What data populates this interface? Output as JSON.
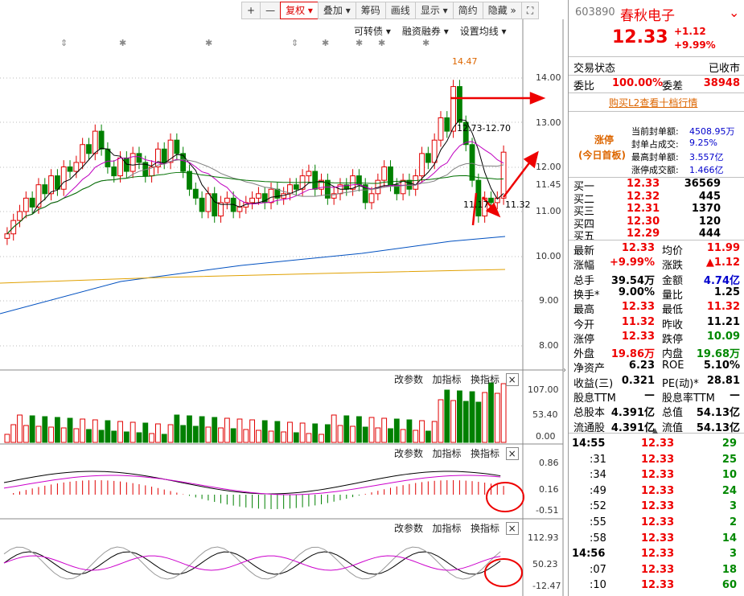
{
  "toolbar": {
    "zoom_in": "+",
    "zoom_out": "—",
    "fuquan": "复权",
    "diejia": "叠加",
    "chouma": "筹码",
    "huaxian": "画线",
    "xianshi": "显示",
    "jianyue": "简约",
    "yincang": "隐藏"
  },
  "chart_menu": {
    "kezhuan": "可转债",
    "rongzi": "融资融券",
    "junxian": "设置均线"
  },
  "price_axis": [
    "14.00",
    "13.00",
    "12.00",
    "11.45",
    "11.00",
    "10.00",
    "9.00",
    "8.00"
  ],
  "annotations": {
    "high": "14.47",
    "mid": "12.73-12.70",
    "low": "11.17",
    "lowr": "11.32"
  },
  "sub_menu": {
    "gai": "改参数",
    "jia": "加指标",
    "huan": "换指标",
    "close": "×"
  },
  "vol_axis": [
    "107.00",
    "53.40",
    "0.00"
  ],
  "macd_axis": [
    "0.86",
    "0.16",
    "-0.51"
  ],
  "kdj_axis": [
    "112.93",
    "50.23",
    "-12.47"
  ],
  "colors": {
    "up": "#e00000",
    "down": "#008000",
    "ma5": "#000000",
    "ma10": "#c000c0",
    "ma20": "#808080",
    "ma60": "#007000",
    "ma120": "#0050c0",
    "ma250": "#e0a000"
  },
  "stock": {
    "code": "603890",
    "name": "春秋电子",
    "price": "12.33",
    "change": "+1.12",
    "pct": "+9.99%"
  },
  "status": {
    "label": "交易状态",
    "value": "已收市"
  },
  "weibi": {
    "l1": "委比",
    "v1": "100.00%",
    "l2": "委差",
    "v2": "38948"
  },
  "l2_link": "购买L2查看十档行情",
  "zt": {
    "title": "涨停",
    "sub": "(今日首板)",
    "r1": "当前封单额:",
    "v1": "4508.95万",
    "r2": "封单占成交:",
    "v2": "9.25%",
    "r3": "最高封单额:",
    "v3": "3.557亿",
    "r4": "涨停成交额:",
    "v4": "1.466亿"
  },
  "bids": [
    [
      "买一",
      "12.33",
      "36569"
    ],
    [
      "买二",
      "12.32",
      "445"
    ],
    [
      "买三",
      "12.31",
      "1370"
    ],
    [
      "买四",
      "12.30",
      "120"
    ],
    [
      "买五",
      "12.29",
      "444"
    ]
  ],
  "quote": [
    [
      "最新",
      "12.33",
      "均价",
      "11.99"
    ],
    [
      "涨幅",
      "+9.99%",
      "涨跌",
      "▲1.12"
    ],
    [
      "总手",
      "39.54万",
      "金额",
      "4.74亿"
    ],
    [
      "换手*",
      "9.00%",
      "量比",
      "1.25"
    ],
    [
      "最高",
      "12.33",
      "最低",
      "11.32"
    ],
    [
      "今开",
      "11.32",
      "昨收",
      "11.21"
    ],
    [
      "涨停",
      "12.33",
      "跌停",
      "10.09"
    ],
    [
      "外盘",
      "19.86万",
      "内盘",
      "19.68万"
    ],
    [
      "净资产",
      "6.23",
      "ROE",
      "5.10%"
    ],
    [
      "收益(三)",
      "0.321",
      "PE(动)*",
      "28.81"
    ],
    [
      "股息TTM",
      "—",
      "股息率TTM",
      "—"
    ],
    [
      "总股本",
      "4.391亿",
      "总值",
      "54.13亿"
    ],
    [
      "流通股",
      "4.391亿",
      "流值",
      "54.13亿"
    ]
  ],
  "ticks": [
    [
      "14:55",
      "12.33",
      "29"
    ],
    [
      ":31",
      "12.33",
      "25"
    ],
    [
      ":34",
      "12.33",
      "10"
    ],
    [
      ":49",
      "12.33",
      "24"
    ],
    [
      ":52",
      "12.33",
      "3"
    ],
    [
      ":55",
      "12.33",
      "2"
    ],
    [
      ":58",
      "12.33",
      "14"
    ],
    [
      "14:56",
      "12.33",
      "3"
    ],
    [
      ":07",
      "12.33",
      "18"
    ],
    [
      ":10",
      "12.33",
      "60"
    ]
  ]
}
